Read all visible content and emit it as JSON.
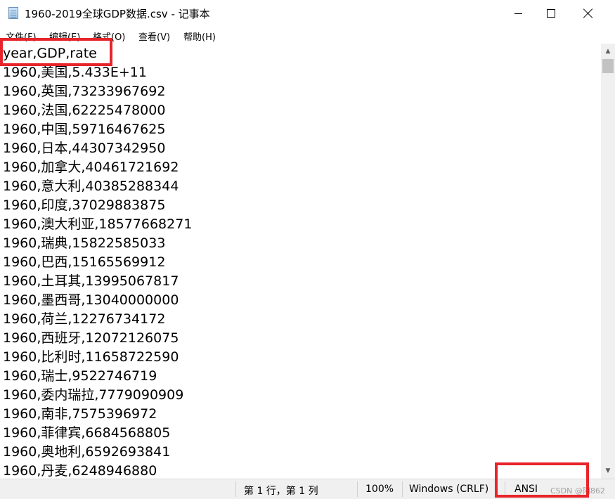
{
  "window": {
    "title": "1960-2019全球GDP数据.csv - 记事本",
    "icon": "notepad-icon"
  },
  "menu": [
    "文件(F)",
    "编辑(E)",
    "格式(O)",
    "查看(V)",
    "帮助(H)"
  ],
  "content": {
    "lines": [
      "year,GDP,rate",
      "1960,美国,5.433E+11",
      "1960,英国,73233967692",
      "1960,法国,62225478000",
      "1960,中国,59716467625",
      "1960,日本,44307342950",
      "1960,加拿大,40461721692",
      "1960,意大利,40385288344",
      "1960,印度,37029883875",
      "1960,澳大利亚,18577668271",
      "1960,瑞典,15822585033",
      "1960,巴西,15165569912",
      "1960,土耳其,13995067817",
      "1960,墨西哥,13040000000",
      "1960,荷兰,12276734172",
      "1960,西班牙,12072126075",
      "1960,比利时,11658722590",
      "1960,瑞士,9522746719",
      "1960,委内瑞拉,7779090909",
      "1960,南非,7575396972",
      "1960,菲律宾,6684568805",
      "1960,奥地利,6592693841",
      "1960,丹麦,6248946880"
    ]
  },
  "status": {
    "position": "第 1 行，第 1 列",
    "zoom": "100%",
    "line_ending": "Windows (CRLF)",
    "encoding": "ANSI",
    "watermark": "CSDN @阳862"
  },
  "colors": {
    "highlight": "#e8242b"
  }
}
